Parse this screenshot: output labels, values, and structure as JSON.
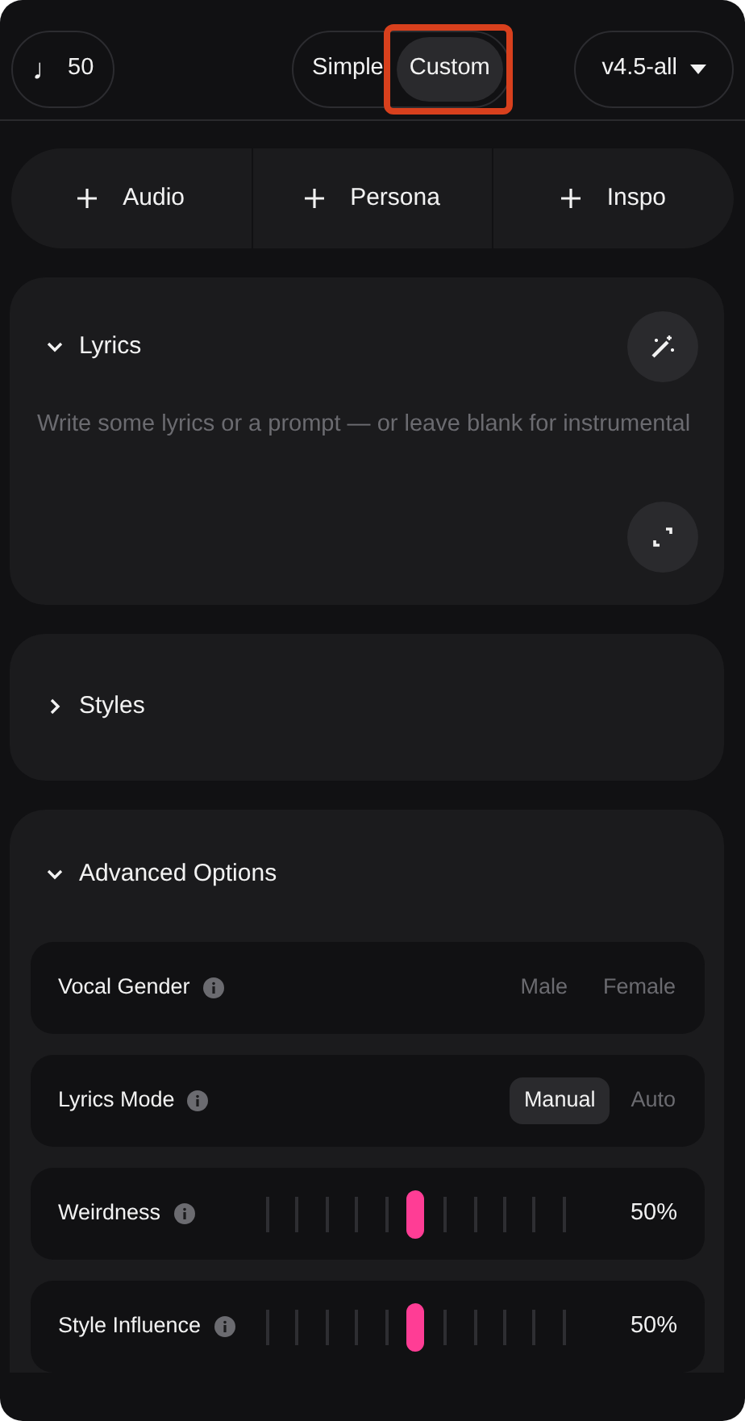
{
  "top_bar": {
    "credits": {
      "icon": "♩",
      "count": "50"
    },
    "mode_tabs": [
      {
        "label": "Simple",
        "selected": false
      },
      {
        "label": "Custom",
        "selected": true,
        "highlighted": true
      }
    ],
    "model": {
      "label": "v4.5-all"
    }
  },
  "add_buttons": [
    {
      "label": "Audio"
    },
    {
      "label": "Persona"
    },
    {
      "label": "Inspo"
    }
  ],
  "sections": [
    {
      "kind": "lyrics",
      "title": "Lyrics",
      "expanded": true,
      "placeholder": "Write some lyrics or a prompt — or leave blank for instrumental"
    },
    {
      "kind": "styles",
      "title": "Styles",
      "expanded": false
    },
    {
      "kind": "advanced",
      "title": "Advanced Options",
      "expanded": true,
      "options": [
        {
          "kind": "choice",
          "label": "Vocal Gender",
          "choices": [
            {
              "label": "Male",
              "selected": false
            },
            {
              "label": "Female",
              "selected": false
            }
          ]
        },
        {
          "kind": "choice",
          "label": "Lyrics Mode",
          "choices": [
            {
              "label": "Manual",
              "selected": true
            },
            {
              "label": "Auto",
              "selected": false
            }
          ]
        },
        {
          "kind": "slider",
          "label": "Weirdness",
          "level": 0.5,
          "reading": "50%"
        },
        {
          "kind": "slider",
          "label": "Style Influence",
          "level": 0.5,
          "reading": "50%"
        }
      ]
    }
  ]
}
